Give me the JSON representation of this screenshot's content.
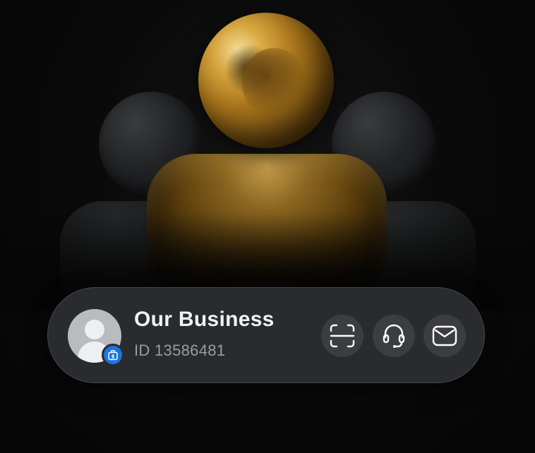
{
  "profile": {
    "name": "Our Business",
    "id_label": "ID 13586481"
  },
  "icons": {
    "avatar": "person-placeholder-icon",
    "badge": "business-briefcase-icon",
    "scan": "scan-qr-icon",
    "support": "headset-support-icon",
    "messages": "envelope-icon"
  },
  "colors": {
    "card_background": "#2a2b2e",
    "badge_blue": "#1b74e4",
    "action_button": "#3c3d41",
    "gold": "#b8892a"
  }
}
